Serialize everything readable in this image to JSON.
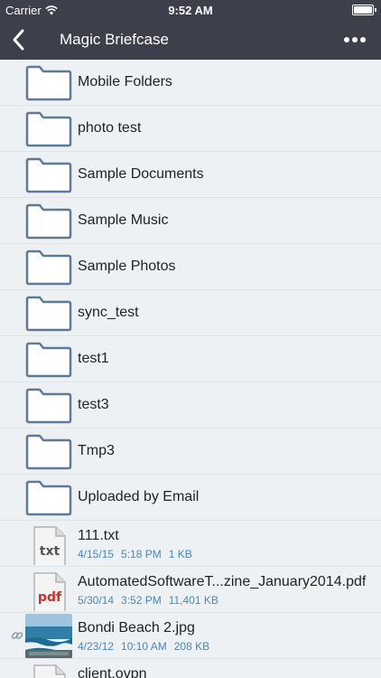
{
  "status_bar": {
    "carrier": "Carrier",
    "time": "9:52 AM"
  },
  "nav": {
    "title": "Magic Briefcase"
  },
  "folders": [
    {
      "name": "Mobile Folders"
    },
    {
      "name": "photo test"
    },
    {
      "name": "Sample Documents"
    },
    {
      "name": "Sample Music"
    },
    {
      "name": "Sample Photos"
    },
    {
      "name": "sync_test"
    },
    {
      "name": "test1"
    },
    {
      "name": "test3"
    },
    {
      "name": "Tmp3"
    },
    {
      "name": "Uploaded by Email"
    }
  ],
  "files": [
    {
      "name": "111.txt",
      "date": "4/15/15",
      "time": "5:18 PM",
      "size": "1 KB",
      "badge": "txt"
    },
    {
      "name": "AutomatedSoftwareT...zine_January2014.pdf",
      "date": "5/30/14",
      "time": "3:52 PM",
      "size": "11,401 KB",
      "badge": "pdf"
    },
    {
      "name": "Bondi Beach 2.jpg",
      "date": "4/23/12",
      "time": "10:10 AM",
      "size": "208 KB"
    },
    {
      "name": "client.ovpn"
    }
  ],
  "colors": {
    "bar": "#3d3f4a",
    "folder_stroke": "#5f7a96",
    "meta": "#4a88bc",
    "pdf": "#c9302c"
  }
}
